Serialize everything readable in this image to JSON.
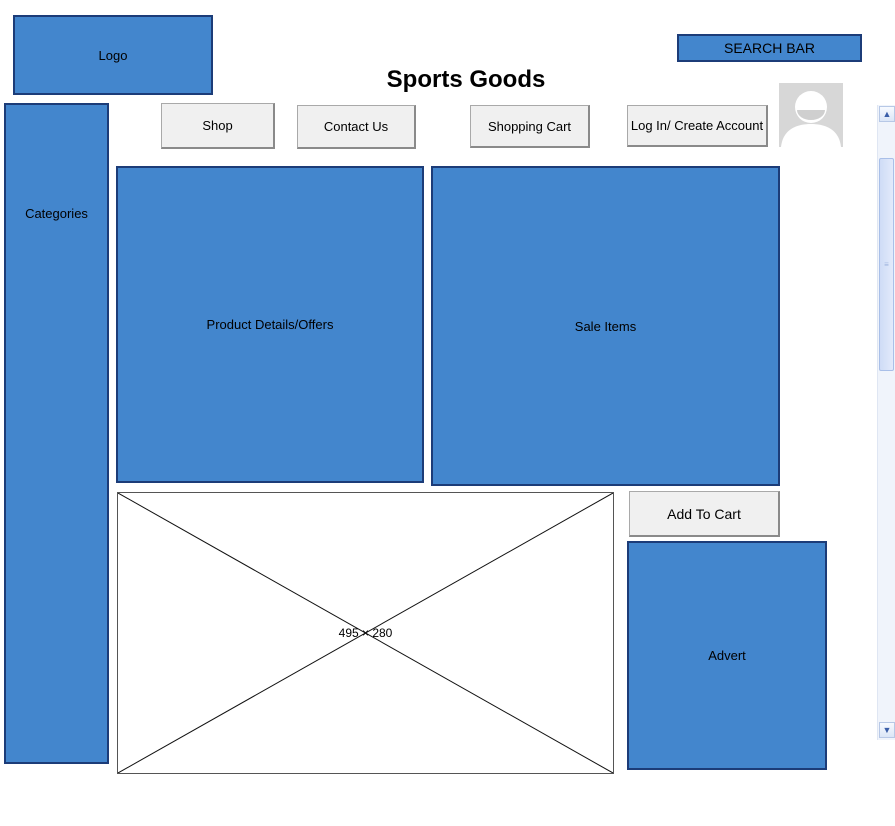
{
  "header": {
    "logo_label": "Logo",
    "title": "Sports Goods",
    "search_label": "SEARCH BAR"
  },
  "nav": {
    "shop": "Shop",
    "contact": "Contact Us",
    "cart": "Shopping Cart",
    "login": "Log In/ Create Account"
  },
  "sidebar": {
    "categories_label": "Categories"
  },
  "main": {
    "product_details_label": "Product Details/Offers",
    "sale_items_label": "Sale Items",
    "image_placeholder_label": "495 × 280",
    "add_to_cart_label": "Add To Cart",
    "advert_label": "Advert"
  },
  "colors": {
    "block_fill": "#4386cd",
    "block_border": "#1c3c78",
    "button_fill": "#f0f0f0"
  },
  "icons": {
    "avatar": "user-avatar-icon",
    "scroll_up": "chevron-up-icon",
    "scroll_down": "chevron-down-icon"
  }
}
